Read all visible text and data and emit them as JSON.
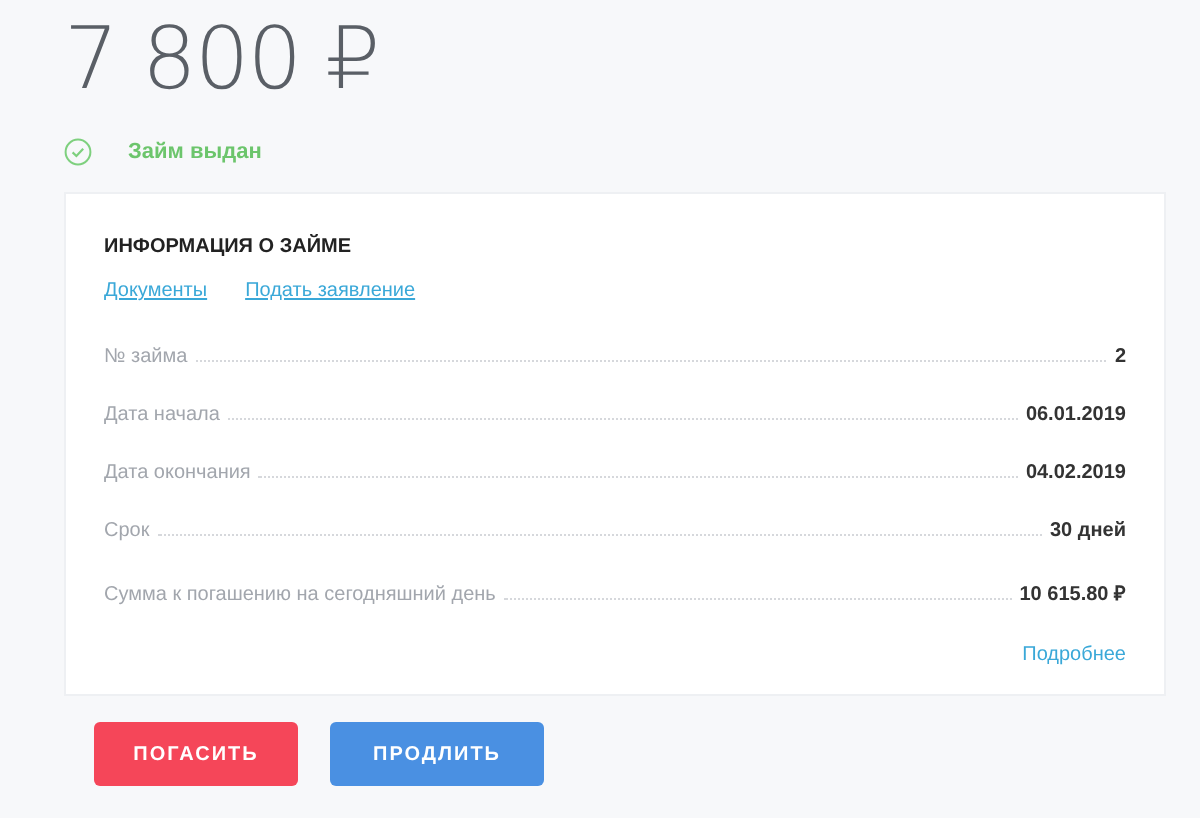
{
  "amount": "7 800 ₽",
  "status": {
    "label": "Займ выдан"
  },
  "card": {
    "title": "ИНФОРМАЦИЯ О ЗАЙМЕ",
    "links": [
      "Документы",
      "Подать заявление"
    ],
    "rows": [
      {
        "label": "№ займа",
        "value": "2"
      },
      {
        "label": "Дата начала",
        "value": "06.01.2019"
      },
      {
        "label": "Дата окончания",
        "value": "04.02.2019"
      },
      {
        "label": "Срок",
        "value": "30 дней"
      },
      {
        "label": "Сумма к погашению на сегодняшний день",
        "value": "10 615.80 ₽"
      }
    ],
    "more_link": "Подробнее"
  },
  "buttons": [
    {
      "label": "ПОГАСИТЬ",
      "kind": "danger"
    },
    {
      "label": "ПРОДЛИТЬ",
      "kind": "primary"
    }
  ]
}
